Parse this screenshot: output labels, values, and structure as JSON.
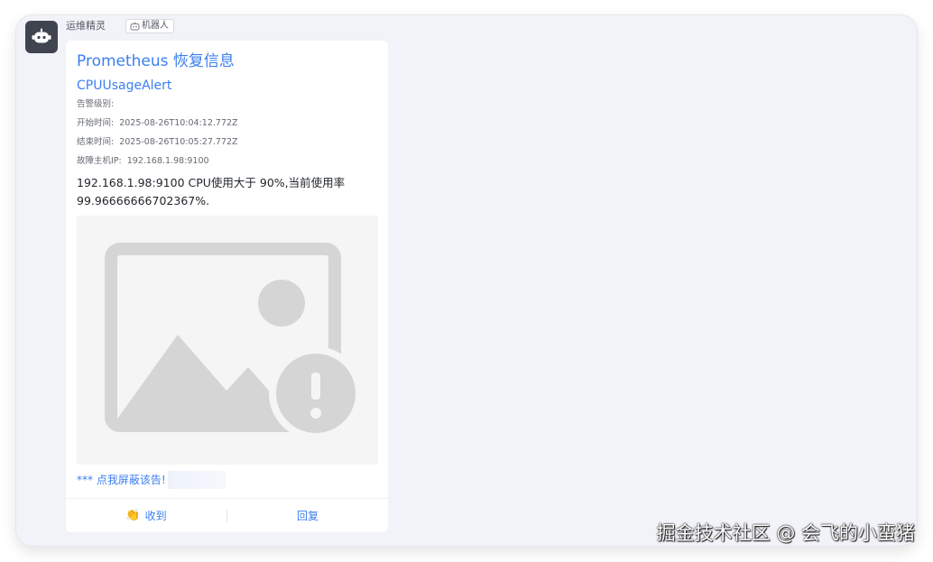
{
  "sender": {
    "name": "运维精灵",
    "tag": "机器人",
    "avatar_icon": "robot-icon",
    "avatar_bg": "#3f4450"
  },
  "card": {
    "title": "Prometheus 恢复信息",
    "subtitle": "CPUUsageAlert",
    "fields": [
      {
        "label": "告警级别:",
        "value": ""
      },
      {
        "label": "开始时间:",
        "value": "2025-08-26T10:04:12.772Z"
      },
      {
        "label": "结束时间:",
        "value": "2025-08-26T10:05:27.772Z"
      },
      {
        "label": "故障主机IP:",
        "value": "192.168.1.98:9100"
      }
    ],
    "description": "192.168.1.98:9100 CPU使用大于 90%,当前使用率 99.96666666702367%.",
    "image_icon": "broken-image-icon",
    "mask_link": "*** 点我屏蔽该告!",
    "actions": [
      {
        "label": "收到",
        "icon": "clap-icon"
      },
      {
        "label": "回复",
        "icon": ""
      }
    ]
  },
  "watermark": "掘金技术社区 @ 会飞的小蛮猪",
  "colors": {
    "accent": "#3c7ff0",
    "panel_bg": "#f2f3f8",
    "text_secondary": "#666a73"
  }
}
